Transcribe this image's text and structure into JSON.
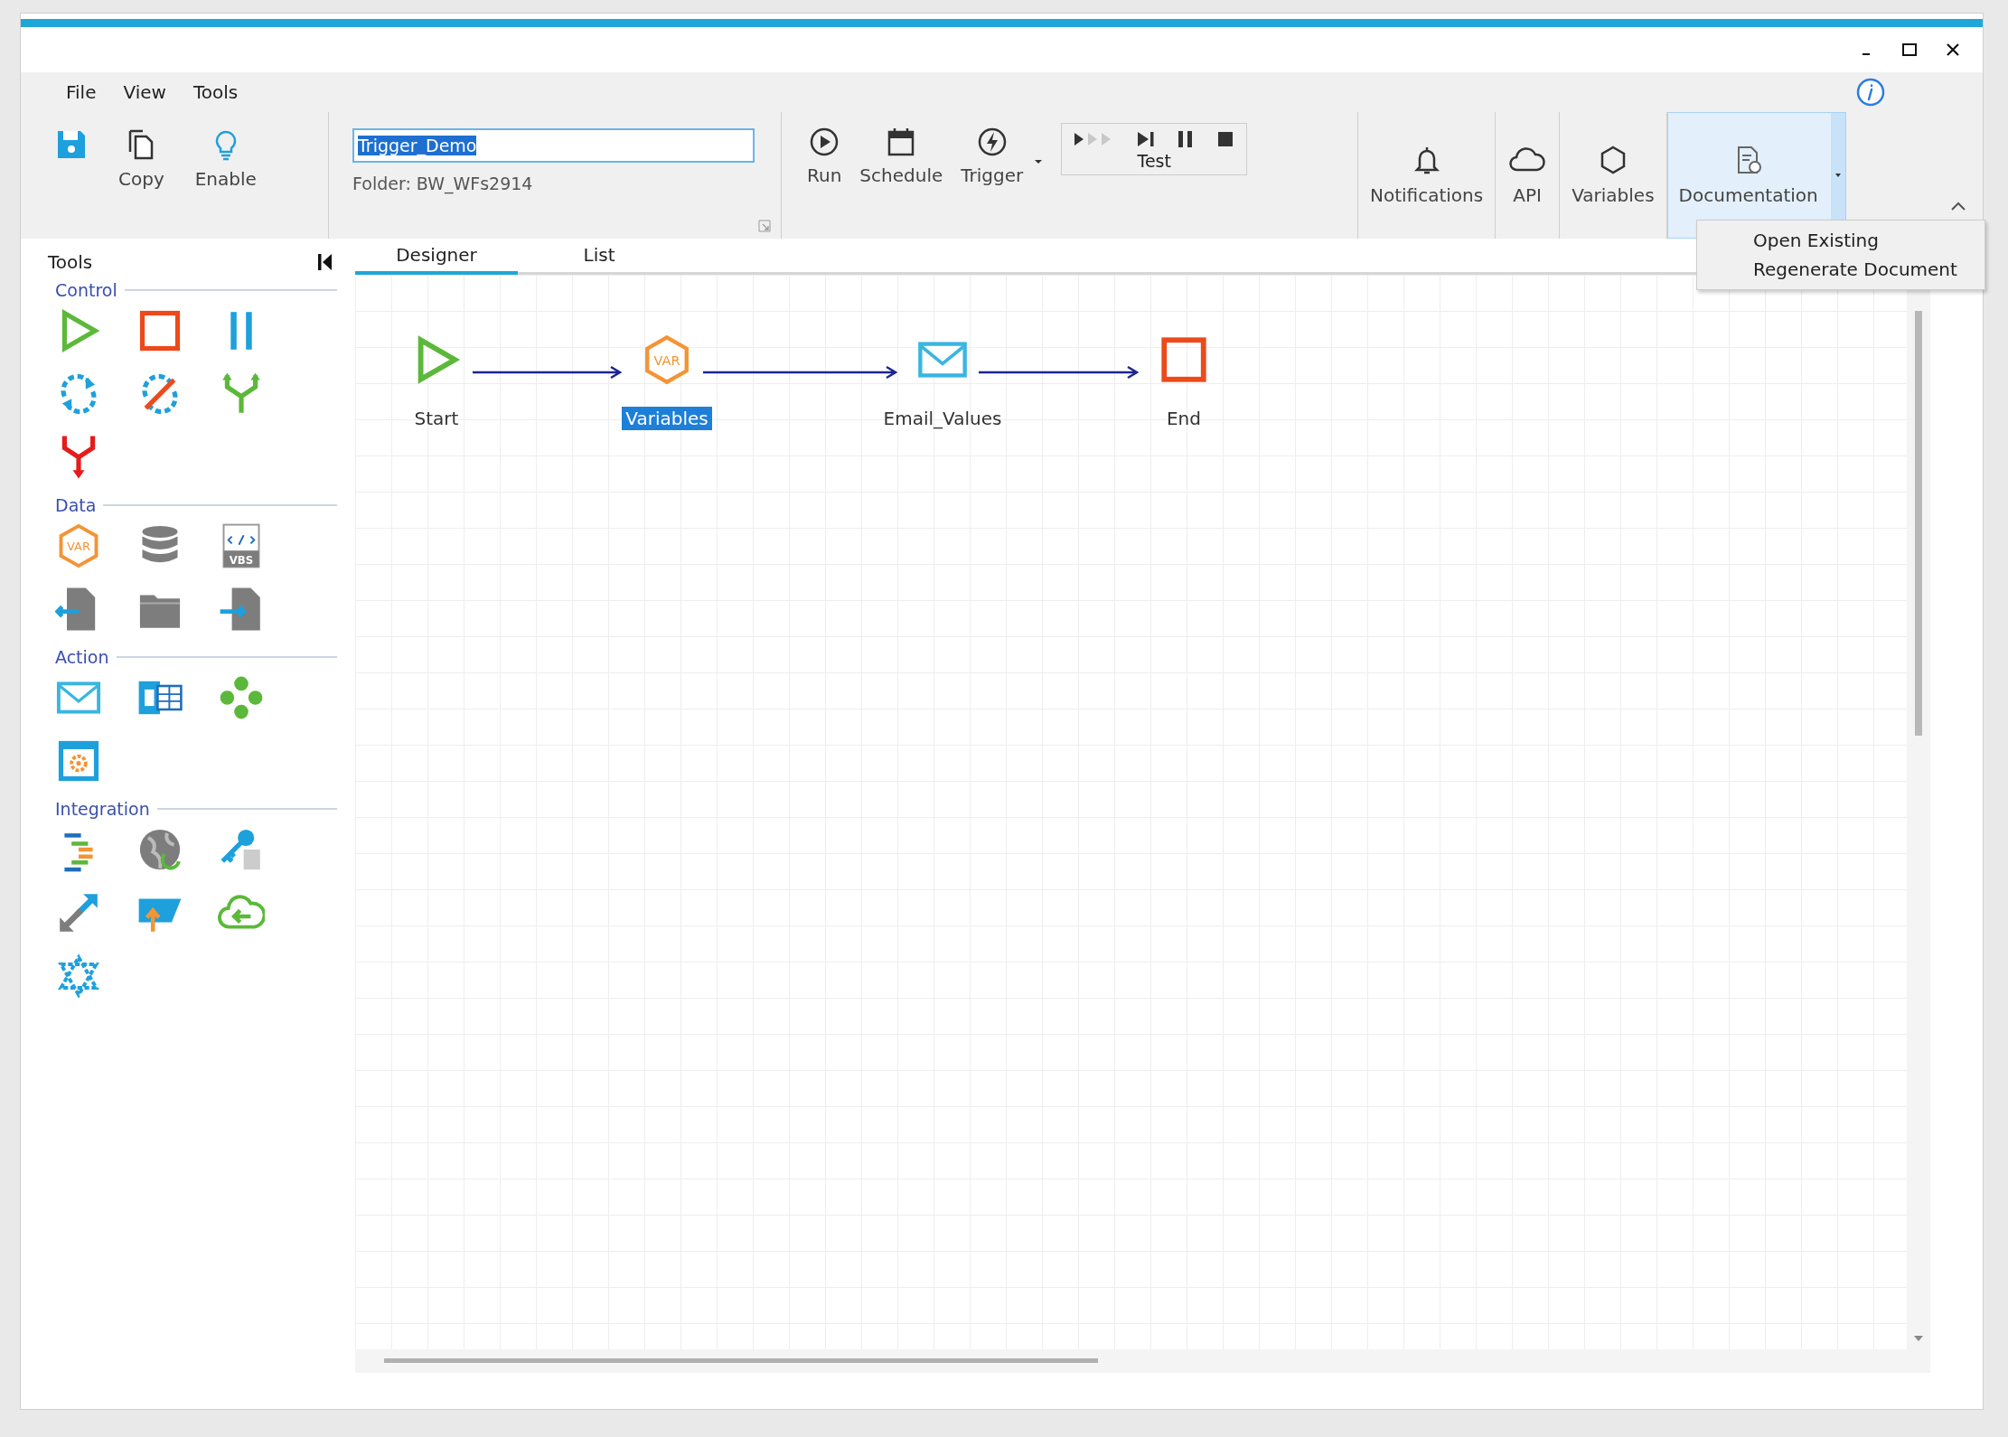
{
  "menu": [
    "File",
    "View",
    "Tools"
  ],
  "file_buttons": [
    {
      "kind": "save"
    },
    {
      "kind": "copy",
      "label": "Copy"
    },
    {
      "kind": "enable",
      "label": "Enable"
    }
  ],
  "workflow_name": {
    "value": "Trigger_Demo",
    "selected": true
  },
  "folder": "Folder: BW_WFs2914",
  "run_buttons": [
    {
      "kind": "run",
      "label": "Run",
      "dropdown": false
    },
    {
      "kind": "schedule",
      "label": "Schedule",
      "dropdown": false
    },
    {
      "kind": "trigger",
      "label": "Trigger",
      "dropdown": true
    }
  ],
  "test_group": {
    "label": "Test",
    "buttons": [
      {
        "kind": "run-all",
        "disabled": true
      },
      {
        "kind": "step",
        "disabled": false
      },
      {
        "kind": "pause",
        "disabled": false
      },
      {
        "kind": "stop",
        "disabled": false
      }
    ]
  },
  "feature_buttons": [
    {
      "kind": "bell",
      "label": "Notifications",
      "selected": false,
      "dropdown": false
    },
    {
      "kind": "cloud",
      "label": "API",
      "selected": false,
      "dropdown": false
    },
    {
      "kind": "hexagon",
      "label": "Variables",
      "selected": false,
      "dropdown": false
    },
    {
      "kind": "document",
      "label": "Documentation",
      "selected": true,
      "dropdown": true
    }
  ],
  "dropdown_menu": [
    "Open Existing",
    "Regenerate Document"
  ],
  "tools_panel": {
    "title": "Tools",
    "sections": [
      {
        "title": "Control",
        "items": [
          {
            "kind": "play"
          },
          {
            "kind": "square"
          },
          {
            "kind": "pause"
          },
          {
            "kind": "loop"
          },
          {
            "kind": "no-loop"
          },
          {
            "kind": "fork"
          },
          {
            "kind": "merge"
          }
        ]
      },
      {
        "title": "Data",
        "items": [
          {
            "kind": "var",
            "text": "VAR"
          },
          {
            "kind": "database"
          },
          {
            "kind": "script",
            "text": "VBS"
          },
          {
            "kind": "file-swap"
          },
          {
            "kind": "folder"
          },
          {
            "kind": "file-in"
          }
        ]
      },
      {
        "title": "Action",
        "items": [
          {
            "kind": "envelope"
          },
          {
            "kind": "sheet"
          },
          {
            "kind": "dots"
          },
          {
            "kind": "window-gear"
          }
        ]
      },
      {
        "title": "Integration",
        "items": [
          {
            "kind": "lines"
          },
          {
            "kind": "globe"
          },
          {
            "kind": "key"
          },
          {
            "kind": "arrows"
          },
          {
            "kind": "upload"
          },
          {
            "kind": "cloud-arrow"
          },
          {
            "kind": "network"
          }
        ]
      }
    ]
  },
  "tabs": [
    {
      "label": "Designer",
      "selected": true
    },
    {
      "label": "List",
      "selected": false
    }
  ],
  "workflow": {
    "nodes": [
      {
        "kind": "play",
        "label": "Start",
        "selected": false
      },
      {
        "kind": "var",
        "text": "VAR",
        "label": "Variables",
        "selected": true
      },
      {
        "kind": "envelope",
        "label": "Email_Values",
        "selected": false
      },
      {
        "kind": "square",
        "label": "End",
        "selected": false
      }
    ]
  }
}
